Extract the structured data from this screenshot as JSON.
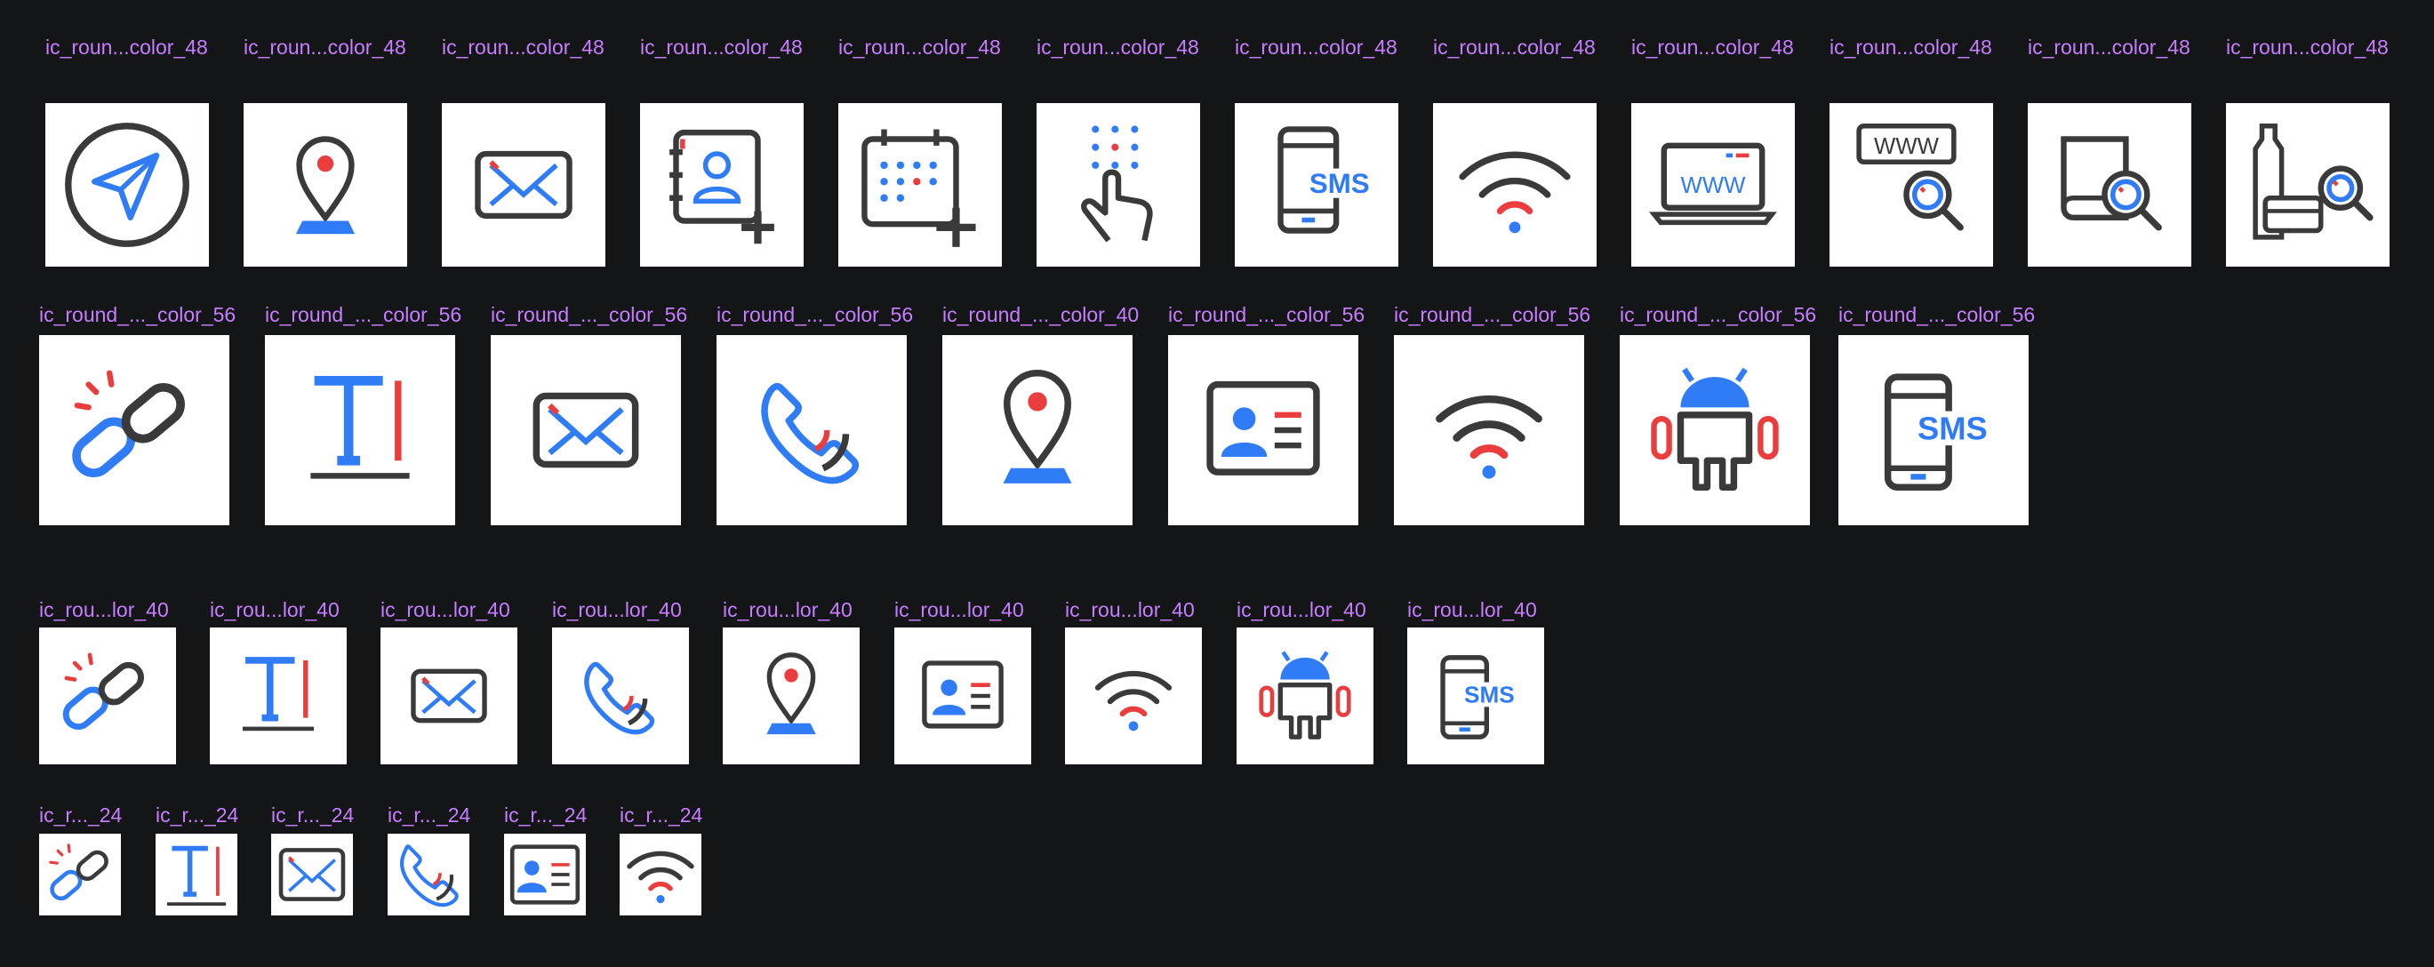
{
  "colors": {
    "background": "#141517",
    "label": "#c77dff",
    "tile": "#ffffff",
    "ink": "#3a3a3a",
    "blue": "#2f7cf6",
    "red": "#ea3e3e"
  },
  "rows": [
    {
      "name": "row-48",
      "frames": [
        {
          "label": "ic_roun...color_48",
          "icon": "send-icon"
        },
        {
          "label": "ic_roun...color_48",
          "icon": "location-pin-icon"
        },
        {
          "label": "ic_roun...color_48",
          "icon": "mail-icon"
        },
        {
          "label": "ic_roun...color_48",
          "icon": "add-contact-icon"
        },
        {
          "label": "ic_roun...color_48",
          "icon": "add-calendar-icon"
        },
        {
          "label": "ic_roun...color_48",
          "icon": "dialpad-touch-icon"
        },
        {
          "label": "ic_roun...color_48",
          "icon": "sms-phone-icon",
          "text": "SMS"
        },
        {
          "label": "ic_roun...color_48",
          "icon": "wifi-icon"
        },
        {
          "label": "ic_roun...color_48",
          "icon": "laptop-www-icon",
          "text": "WWW"
        },
        {
          "label": "ic_roun...color_48",
          "icon": "web-search-icon",
          "text": "WWW"
        },
        {
          "label": "ic_roun...color_48",
          "icon": "book-search-icon"
        },
        {
          "label": "ic_roun...color_48",
          "icon": "product-search-icon"
        }
      ]
    },
    {
      "name": "row-56",
      "frames": [
        {
          "label": "ic_round_..._color_56",
          "icon": "link-icon"
        },
        {
          "label": "ic_round_..._color_56",
          "icon": "text-icon"
        },
        {
          "label": "ic_round_..._color_56",
          "icon": "mail-icon"
        },
        {
          "label": "ic_round_..._color_56",
          "icon": "phone-icon"
        },
        {
          "label": "ic_round_..._color_40",
          "icon": "location-pin-icon"
        },
        {
          "label": "ic_round_..._color_56",
          "icon": "contact-card-icon"
        },
        {
          "label": "ic_round_..._color_56",
          "icon": "wifi-icon"
        },
        {
          "label": "ic_round_..._color_56",
          "icon": "android-icon"
        },
        {
          "label": "ic_round_..._color_56",
          "icon": "sms-phone-icon",
          "text": "SMS"
        }
      ]
    },
    {
      "name": "row-40",
      "frames": [
        {
          "label": "ic_rou...lor_40",
          "icon": "link-icon"
        },
        {
          "label": "ic_rou...lor_40",
          "icon": "text-icon"
        },
        {
          "label": "ic_rou...lor_40",
          "icon": "mail-icon"
        },
        {
          "label": "ic_rou...lor_40",
          "icon": "phone-icon"
        },
        {
          "label": "ic_rou...lor_40",
          "icon": "location-pin-icon"
        },
        {
          "label": "ic_rou...lor_40",
          "icon": "contact-card-icon"
        },
        {
          "label": "ic_rou...lor_40",
          "icon": "wifi-icon"
        },
        {
          "label": "ic_rou...lor_40",
          "icon": "android-icon"
        },
        {
          "label": "ic_rou...lor_40",
          "icon": "sms-phone-icon",
          "text": "SMS"
        }
      ]
    },
    {
      "name": "row-24",
      "frames": [
        {
          "label": "ic_r..._24",
          "icon": "link-icon"
        },
        {
          "label": "ic_r..._24",
          "icon": "text-icon"
        },
        {
          "label": "ic_r..._24",
          "icon": "mail-icon"
        },
        {
          "label": "ic_r..._24",
          "icon": "phone-icon"
        },
        {
          "label": "ic_r..._24",
          "icon": "contact-card-icon"
        },
        {
          "label": "ic_r..._24",
          "icon": "wifi-icon"
        }
      ]
    }
  ]
}
